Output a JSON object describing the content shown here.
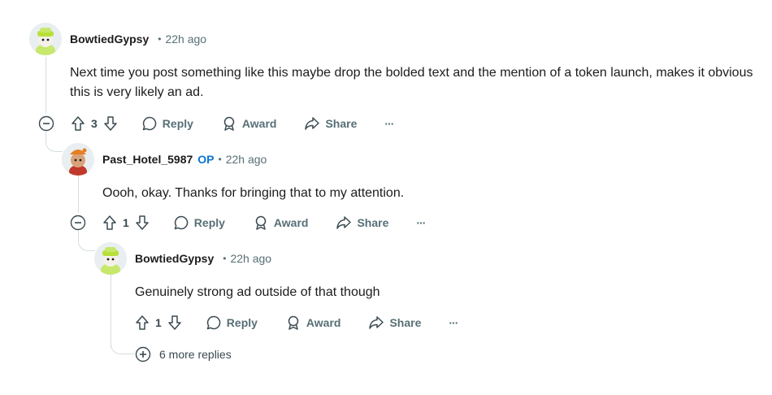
{
  "comments": [
    {
      "author": "BowtiedGypsy",
      "op": "",
      "time": "22h ago",
      "text": "Next time you post something like this maybe drop the bolded text and the mention of a token launch, makes it obvious this is very likely an ad.",
      "score": "3",
      "avatar": "green-hat-avatar"
    },
    {
      "author": "Past_Hotel_5987",
      "op": "OP",
      "time": "22h ago",
      "text": "Oooh, okay. Thanks for bringing that to my attention.",
      "score": "1",
      "avatar": "orange-character-avatar"
    },
    {
      "author": "BowtiedGypsy",
      "op": "",
      "time": "22h ago",
      "text": "Genuinely strong ad outside of that though",
      "score": "1",
      "avatar": "green-hat-avatar"
    }
  ],
  "actions": {
    "reply": "Reply",
    "award": "Award",
    "share": "Share",
    "more": "···"
  },
  "more_replies": "6 more replies",
  "separator": "•",
  "colors": {
    "op": "#0a74d1",
    "meta": "#576f76",
    "thread": "#d6dde0",
    "text": "#1c1c1c"
  }
}
